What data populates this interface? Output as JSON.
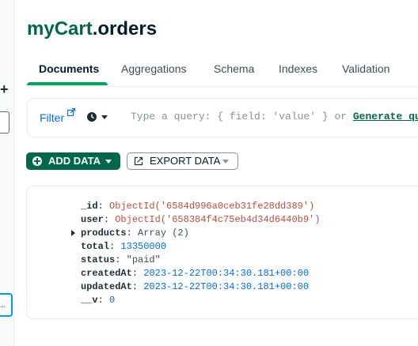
{
  "sidebar": {
    "plus_glyph": "+",
    "more_glyph": "..."
  },
  "header": {
    "db_name": "myCart",
    "coll_name": ".orders"
  },
  "tabs": [
    {
      "label": "Documents",
      "active": true
    },
    {
      "label": "Aggregations",
      "active": false
    },
    {
      "label": "Schema",
      "active": false
    },
    {
      "label": "Indexes",
      "active": false
    },
    {
      "label": "Validation",
      "active": false
    }
  ],
  "query": {
    "filter_label": "Filter",
    "placeholder": "Type a query: { field: 'value' } or ",
    "generate_link": "Generate query"
  },
  "toolbar": {
    "add_data_label": "ADD DATA",
    "export_data_label": "EXPORT DATA"
  },
  "document": {
    "fields": [
      {
        "key": "_id",
        "value": "ObjectId('6584d996a0ceb31fe28dd389')",
        "type": "oid"
      },
      {
        "key": "user",
        "value": "ObjectId('658384f4c75eb4d34d6440b9')",
        "type": "oid"
      },
      {
        "key": "products",
        "value": "Array (2)",
        "type": "plain",
        "expandable": true
      },
      {
        "key": "total",
        "value": "13350000",
        "type": "num"
      },
      {
        "key": "status",
        "value": "\"paid\"",
        "type": "str"
      },
      {
        "key": "createdAt",
        "value": "2023-12-22T00:34:30.181+00:00",
        "type": "date"
      },
      {
        "key": "updatedAt",
        "value": "2023-12-22T00:34:30.181+00:00",
        "type": "date"
      },
      {
        "key": "__v",
        "value": "0",
        "type": "num"
      }
    ]
  },
  "colors": {
    "brand_green": "#00684a",
    "accent_green": "#00a35c",
    "link_blue": "#016bf8",
    "oid_red": "#c14e3a"
  },
  "icons": {
    "external_link": "external-link-icon",
    "history": "clock-icon",
    "add": "plus-circle-icon",
    "export": "export-icon",
    "caret": "chevron-down-icon",
    "expand": "chevron-right-icon"
  }
}
